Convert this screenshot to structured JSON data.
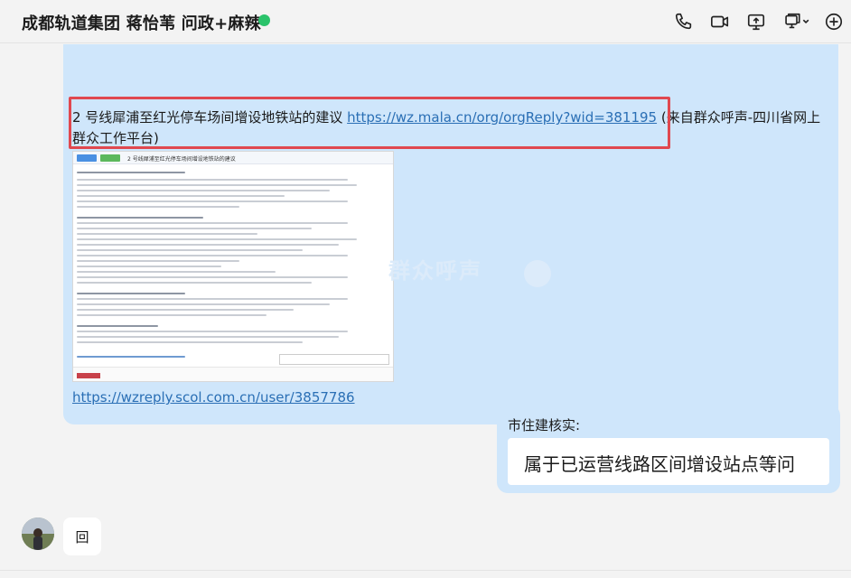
{
  "header": {
    "title": "成都轨道集团 蒋怡苇 问政+麻辣",
    "status": "online",
    "icons": [
      "phone-icon",
      "video-icon",
      "screen-share-icon",
      "more-devices-icon",
      "add-icon"
    ]
  },
  "messages": {
    "first": {
      "text": "2 号线犀浦至红光停车场间增设地铁站的建议",
      "link": "https://wz.mala.cn/org/orgReply?wid=381195",
      "source": "(来自群众呼声-四川省网上群众工作平台)",
      "screenshot": {
        "title_line": "2 号线犀浦至红光停车场间增设地铁站的建议",
        "watermark": "群众呼声"
      },
      "link2": "https://wzreply.scol.com.cn/user/3857786"
    },
    "second": {
      "label": "市住建核实:",
      "card_text": "属于已运营线路区间增设站点等问"
    },
    "third": {
      "text": "回"
    }
  },
  "colors": {
    "bubble": "#cfe6fb",
    "link": "#2a6fb5",
    "highlight": "#e0484f",
    "online": "#2bc36b"
  }
}
